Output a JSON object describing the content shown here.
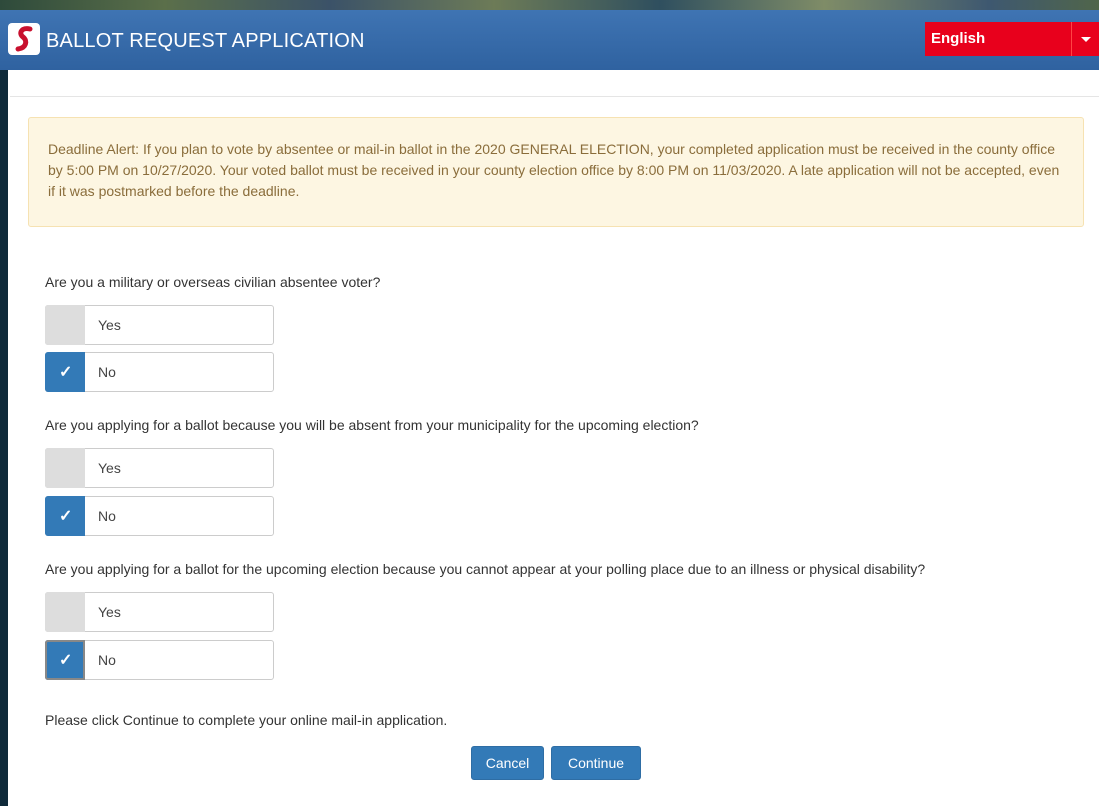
{
  "header": {
    "title": "BALLOT REQUEST APPLICATION",
    "language": {
      "selected": "English"
    },
    "accent_color": "#2f62a0"
  },
  "alert": {
    "text": "Deadline Alert: If you plan to vote by absentee or mail-in ballot in the 2020 GENERAL ELECTION, your completed application must be received in the county office by 5:00 PM on 10/27/2020. Your voted ballot must be received in your county election office by 8:00 PM on 11/03/2020. A late application will not be accepted, even if it was postmarked before the deadline."
  },
  "questions": [
    {
      "text": "Are you a military or overseas civilian absentee voter?",
      "options": [
        {
          "label": "Yes",
          "checked": false
        },
        {
          "label": "No",
          "checked": true
        }
      ]
    },
    {
      "text": "Are you applying for a ballot because you will be absent from your municipality for the upcoming election?",
      "options": [
        {
          "label": "Yes",
          "checked": false
        },
        {
          "label": "No",
          "checked": true
        }
      ]
    },
    {
      "text": "Are you applying for a ballot for the upcoming election because you cannot appear at your polling place due to an illness or physical disability?",
      "options": [
        {
          "label": "Yes",
          "checked": false
        },
        {
          "label": "No",
          "checked": true
        }
      ]
    }
  ],
  "footer": {
    "note": "Please click Continue to complete your online mail-in application.",
    "cancel_label": "Cancel",
    "continue_label": "Continue"
  },
  "icons": {
    "logo": "state-logo-icon",
    "checkmark": "checkmark-icon",
    "dropdown": "caret-down-icon"
  }
}
